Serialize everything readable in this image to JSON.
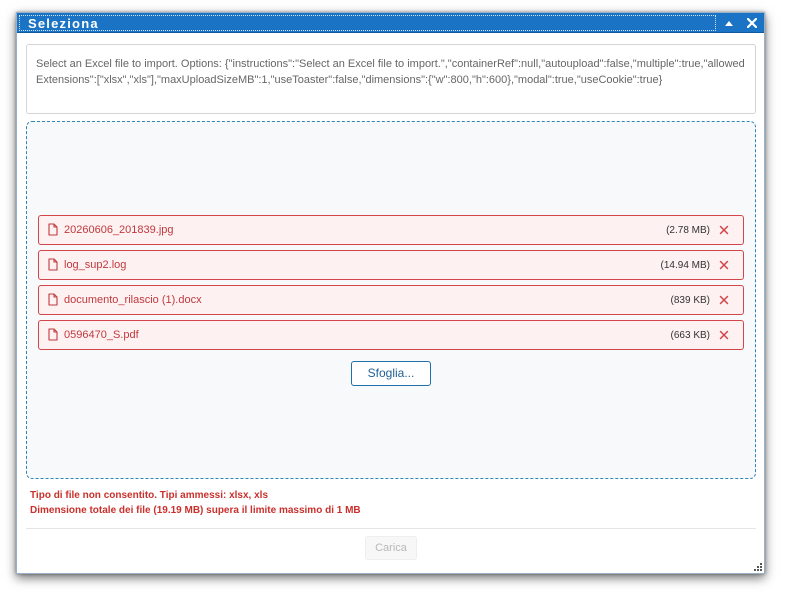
{
  "dialog": {
    "title": "Seleziona",
    "collapse_icon": "caret-up-icon",
    "close_icon": "close-icon"
  },
  "instructions": {
    "text": "Select an Excel file to import. Options: {\"instructions\":\"Select an Excel file to import.\",\"containerRef\":null,\"autoupload\":false,\"multiple\":true,\"allowedExtensions\":[\"xlsx\",\"xls\"],\"maxUploadSizeMB\":1,\"useToaster\":false,\"dimensions\":{\"w\":800,\"h\":600},\"modal\":true,\"useCookie\":true}"
  },
  "files": [
    {
      "name": "20260606_201839.jpg",
      "size": "(2.78 MB)"
    },
    {
      "name": "log_sup2.log",
      "size": "(14.94 MB)"
    },
    {
      "name": "documento_rilascio (1).docx",
      "size": "(839 KB)"
    },
    {
      "name": "0596470_S.pdf",
      "size": "(663 KB)"
    }
  ],
  "browse_label": "Sfoglia...",
  "errors": [
    "Tipo di file non consentito. Tipi ammessi: xlsx, xls",
    "Dimensione totale dei file (19.19 MB) supera il limite massimo di 1 MB"
  ],
  "upload_label": "Carica",
  "colors": {
    "titlebar": "#1a73c4",
    "error": "#c9302c",
    "file_border": "#d2454a",
    "file_bg": "#fdf1f1",
    "dropzone_border": "#2f86b6"
  }
}
